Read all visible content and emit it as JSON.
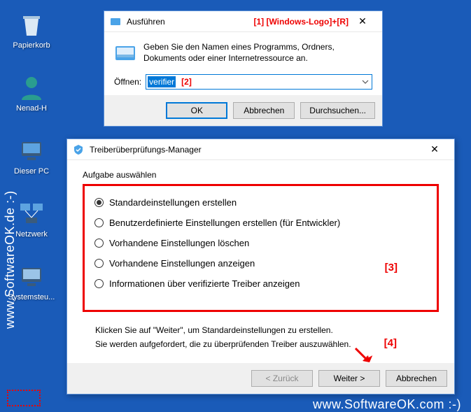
{
  "desktop": {
    "icons": [
      {
        "label": "Papierkorb"
      },
      {
        "label": "Nenad-H"
      },
      {
        "label": "Dieser PC"
      },
      {
        "label": "Netzwerk"
      },
      {
        "label": "Systemsteu..."
      }
    ]
  },
  "run_dialog": {
    "title": "Ausführen",
    "annotation1": "[1] [Windows-Logo]+[R]",
    "description": "Geben Sie den Namen eines Programms, Ordners, Dokuments oder einer Internetressource an.",
    "open_label": "Öffnen:",
    "input_value": "verifier",
    "annotation2": "[2]",
    "ok": "OK",
    "cancel": "Abbrechen",
    "browse": "Durchsuchen..."
  },
  "verifier_dialog": {
    "title": "Treiberüberprüfungs-Manager",
    "group_label": "Aufgabe auswählen",
    "options": [
      "Standardeinstellungen erstellen",
      "Benutzerdefinierte Einstellungen erstellen (für Entwickler)",
      "Vorhandene Einstellungen löschen",
      "Vorhandene Einstellungen anzeigen",
      "Informationen über verifizierte Treiber anzeigen"
    ],
    "annotation3": "[3]",
    "instr1": "Klicken Sie auf \"Weiter\", um Standardeinstellungen zu erstellen.",
    "instr2": "Sie werden aufgefordert, die zu überprüfenden Treiber auszuwählen.",
    "annotation4": "[4]",
    "back": "< Zurück",
    "next": "Weiter >",
    "cancel": "Abbrechen"
  },
  "watermark_left": "www.SoftwareOK.de :-)",
  "watermark_bottom": "www.SoftwareOK.com :-)"
}
